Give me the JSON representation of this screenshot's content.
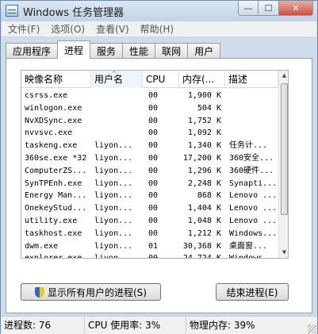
{
  "window": {
    "title": "Windows 任务管理器",
    "controls": {
      "minimize": "—",
      "maximize": "☐",
      "close": "✕"
    }
  },
  "menu": [
    "文件(F)",
    "选项(O)",
    "查看(V)",
    "帮助(H)"
  ],
  "tabs": [
    {
      "label": "应用程序",
      "active": false
    },
    {
      "label": "进程",
      "active": true
    },
    {
      "label": "服务",
      "active": false
    },
    {
      "label": "性能",
      "active": false
    },
    {
      "label": "联网",
      "active": false
    },
    {
      "label": "用户",
      "active": false
    }
  ],
  "process_list": {
    "columns": [
      "映像名称",
      "用户名",
      "CPU",
      "内存(...",
      "描述"
    ],
    "sort_indicator": "^",
    "rows": [
      [
        "csrss.exe",
        "",
        "00",
        "1,900 K",
        ""
      ],
      [
        "winlogon.exe",
        "",
        "00",
        "504 K",
        ""
      ],
      [
        "NvXDSync.exe",
        "",
        "00",
        "1,752 K",
        ""
      ],
      [
        "nvvsvc.exe",
        "",
        "00",
        "1,092 K",
        ""
      ],
      [
        "taskeng.exe",
        "liyon...",
        "00",
        "1,340 K",
        "任务计..."
      ],
      [
        "360se.exe *32",
        "liyon...",
        "00",
        "17,200 K",
        "360安全..."
      ],
      [
        "ComputerZS...",
        "liyon...",
        "00",
        "1,296 K",
        "360硬件..."
      ],
      [
        "SynTPEnh.exe",
        "liyon...",
        "00",
        "2,248 K",
        "Synapti..."
      ],
      [
        "Energy Man...",
        "liyon...",
        "00",
        "868 K",
        "Lenovo ..."
      ],
      [
        "OnekeyStud...",
        "liyon...",
        "00",
        "1,404 K",
        "Lenovo ..."
      ],
      [
        "utility.exe",
        "liyon...",
        "00",
        "1,048 K",
        "Lenovo ..."
      ],
      [
        "taskhost.exe",
        "liyon...",
        "00",
        "1,212 K",
        "Windows..."
      ],
      [
        "dwm.exe",
        "liyon...",
        "01",
        "30,368 K",
        "桌面窗..."
      ],
      [
        "explorer.exe",
        "liyon...",
        "00",
        "24,724 K",
        "Windows..."
      ],
      [
        "bl...d.exe",
        "liyon...",
        "00",
        "848 K",
        "bl...d M..."
      ]
    ]
  },
  "buttons": {
    "show_all": "显示所有用户的进程(S)",
    "end_process": "结束进程(E)"
  },
  "status": {
    "processes": "进程数: 76",
    "cpu": "CPU 使用率: 3%",
    "memory": "物理内存: 39%"
  }
}
